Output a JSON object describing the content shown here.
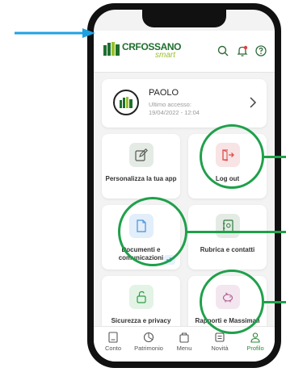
{
  "brand": {
    "name": "CRFOSSANO",
    "subtitle": "smart"
  },
  "profile": {
    "name": "PAOLO",
    "last_access_label": "Ultimo accesso:",
    "last_access_date": "19/04/2022 - 12:04"
  },
  "tiles": [
    {
      "label": "Personalizza la tua app",
      "icon": "edit-icon"
    },
    {
      "label": "Log out",
      "icon": "logout-icon"
    },
    {
      "label": "Documenti e comunicazioni",
      "icon": "document-icon"
    },
    {
      "label": "Rubrica e contatti",
      "icon": "address-book-icon"
    },
    {
      "label": "Sicurezza e privacy",
      "icon": "lock-icon"
    },
    {
      "label": "Rapporti e Massimali",
      "icon": "piggy-bank-icon"
    }
  ],
  "tabs": [
    {
      "label": "Conto",
      "icon": "account-icon"
    },
    {
      "label": "Patrimonio",
      "icon": "pie-chart-icon"
    },
    {
      "label": "Menu",
      "icon": "menu-bag-icon"
    },
    {
      "label": "Novità",
      "icon": "news-icon"
    },
    {
      "label": "Profilo",
      "icon": "user-icon",
      "active": true
    }
  ],
  "colors": {
    "brand_green": "#1f6f2e",
    "brand_lime": "#9bbf2f",
    "annotation_green": "#1fa04a",
    "annotation_arrow": "#1ea1e3",
    "logout_red": "#e05050",
    "document_blue": "#4a90d9"
  }
}
